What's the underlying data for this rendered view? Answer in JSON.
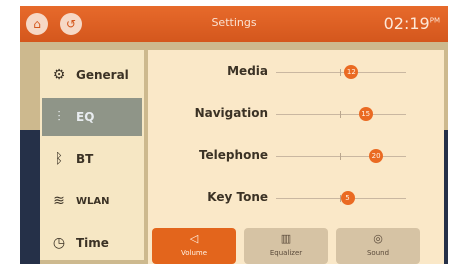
{
  "header": {
    "title": "Settings",
    "time": "02:19",
    "time_suffix": "PM",
    "home_icon": "home-icon",
    "back_icon": "back-icon"
  },
  "sidebar": {
    "items": [
      {
        "label": "General",
        "icon": "gear-icon",
        "glyph": "⚙",
        "active": false
      },
      {
        "label": "EQ",
        "icon": "equalizer-icon",
        "glyph": "⫶",
        "active": true
      },
      {
        "label": "BT",
        "icon": "bluetooth-icon",
        "glyph": "ᛒ",
        "active": false
      },
      {
        "label": "WLAN",
        "icon": "wifi-icon",
        "glyph": "≋",
        "active": false
      },
      {
        "label": "Time",
        "icon": "clock-icon",
        "glyph": "◷",
        "active": false
      }
    ]
  },
  "sliders": [
    {
      "label": "Media",
      "value": 12,
      "fraction": 0.58
    },
    {
      "label": "Navigation",
      "value": 15,
      "fraction": 0.69
    },
    {
      "label": "Telephone",
      "value": 20,
      "fraction": 0.77
    },
    {
      "label": "Key Tone",
      "value": 5,
      "fraction": 0.55
    }
  ],
  "tabs": [
    {
      "label": "Volume",
      "icon": "speaker-icon",
      "glyph": "◁",
      "active": true
    },
    {
      "label": "Equalizer",
      "icon": "equalizer-bars-icon",
      "glyph": "▥",
      "active": false
    },
    {
      "label": "Sound",
      "icon": "sound-icon",
      "glyph": "◎",
      "active": false
    }
  ],
  "colors": {
    "header": "#e06226",
    "accent": "#ea6a22",
    "panel": "#fae8c8",
    "active_sidebar": "#8f9588"
  }
}
